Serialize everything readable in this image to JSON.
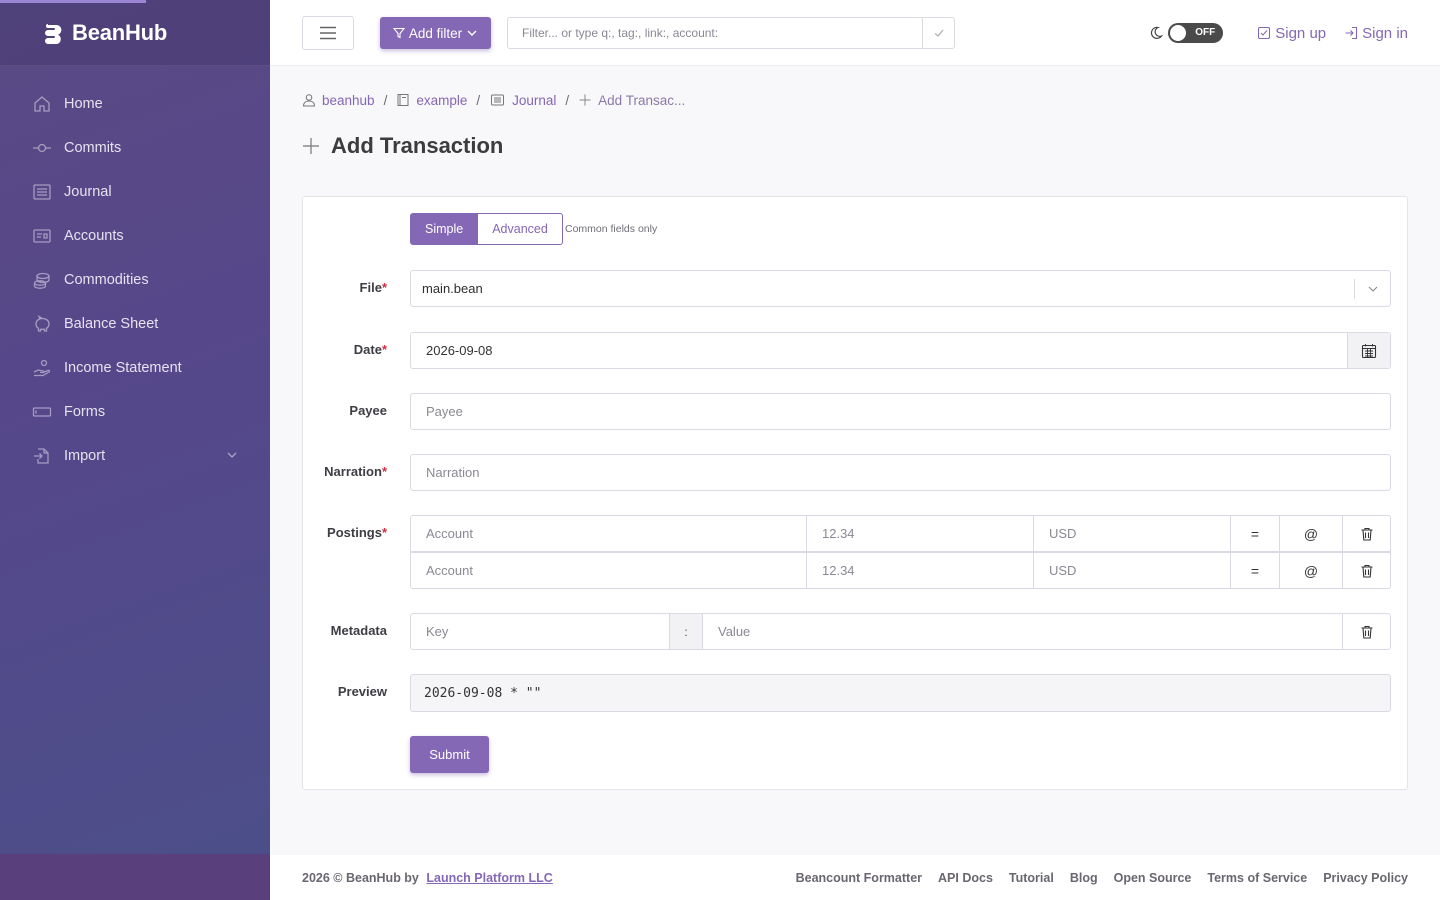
{
  "brand": {
    "name": "BeanHub"
  },
  "sidebar": {
    "items": [
      {
        "label": "Home",
        "icon": "home-icon"
      },
      {
        "label": "Commits",
        "icon": "commit-icon"
      },
      {
        "label": "Journal",
        "icon": "journal-icon"
      },
      {
        "label": "Accounts",
        "icon": "accounts-icon"
      },
      {
        "label": "Commodities",
        "icon": "coins-icon"
      },
      {
        "label": "Balance Sheet",
        "icon": "piggy-bank-icon"
      },
      {
        "label": "Income Statement",
        "icon": "hand-coin-icon"
      },
      {
        "label": "Forms",
        "icon": "form-icon"
      },
      {
        "label": "Import",
        "icon": "import-icon"
      }
    ]
  },
  "header": {
    "add_filter": "Add filter",
    "search_placeholder": "Filter... or type q:, tag:, link:, account:",
    "toggle_label": "OFF",
    "sign_up": "Sign up",
    "sign_in": "Sign in"
  },
  "breadcrumb": [
    "beanhub",
    "example",
    "Journal",
    "Add Transac..."
  ],
  "page": {
    "title": "Add Transaction"
  },
  "form": {
    "mode_simple": "Simple",
    "mode_advanced": "Advanced",
    "mode_note": "Common fields only",
    "labels": {
      "file": "File",
      "date": "Date",
      "payee": "Payee",
      "narration": "Narration",
      "postings": "Postings",
      "metadata": "Metadata",
      "preview": "Preview"
    },
    "required_mark": "*",
    "file_value": "main.bean",
    "date_value": "2026-09-08",
    "payee_placeholder": "Payee",
    "narration_placeholder": "Narration",
    "postings": [
      {
        "account_placeholder": "Account",
        "amount_placeholder": "12.34",
        "currency_placeholder": "USD",
        "eq": "=",
        "at": "@"
      },
      {
        "account_placeholder": "Account",
        "amount_placeholder": "12.34",
        "currency_placeholder": "USD",
        "eq": "=",
        "at": "@"
      }
    ],
    "metadata": {
      "key_placeholder": "Key",
      "separator": ":",
      "value_placeholder": "Value"
    },
    "preview_text": "2026-09-08 * \"\"",
    "submit": "Submit"
  },
  "footer": {
    "copyright": "2026 © BeanHub by",
    "company": "Launch Platform LLC",
    "links": [
      "Beancount Formatter",
      "API Docs",
      "Tutorial",
      "Blog",
      "Open Source",
      "Terms of Service",
      "Privacy Policy"
    ]
  },
  "colors": {
    "accent": "#8467b5",
    "sidebar": "#56478a",
    "required": "#d12c3f"
  }
}
